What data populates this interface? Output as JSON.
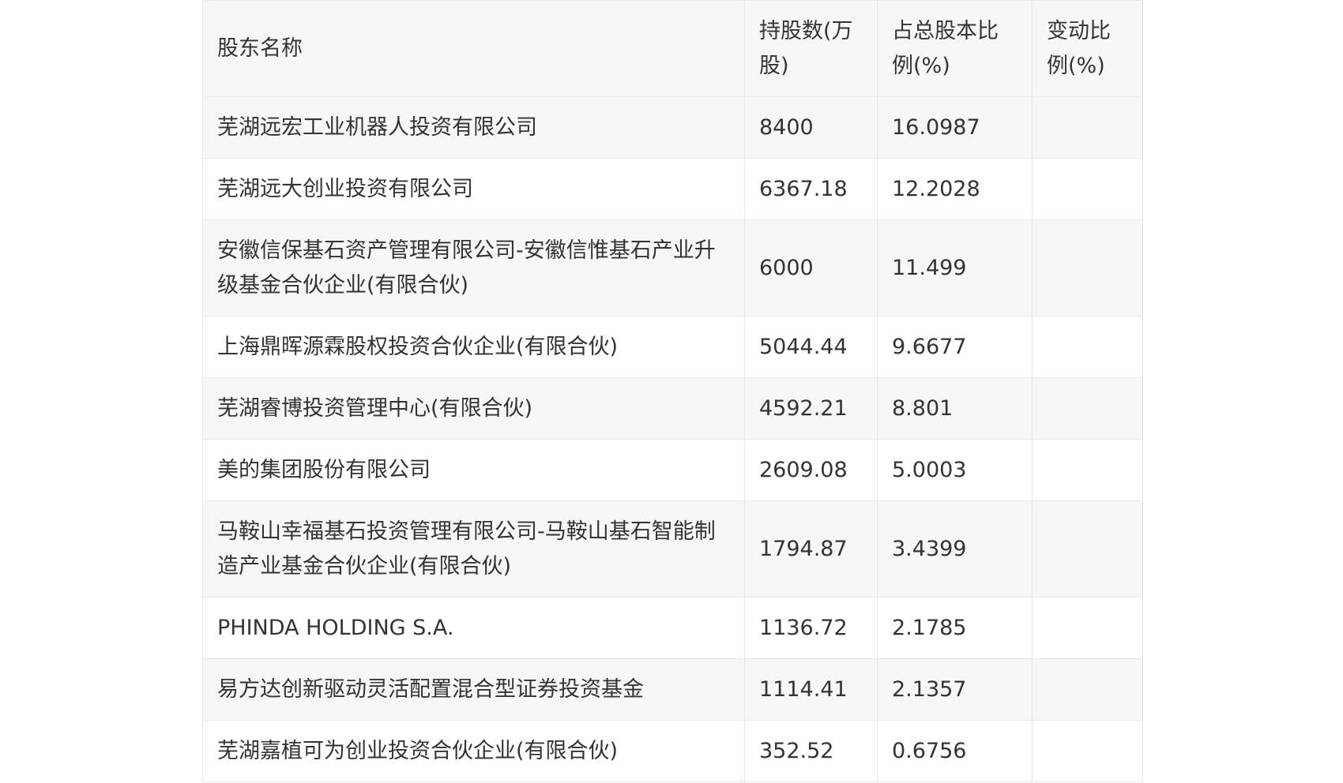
{
  "table": {
    "headers": [
      "股东名称",
      "持股数(万股)",
      "占总股本比例(%)",
      "变动比例(%)"
    ],
    "rows": [
      {
        "name": "芜湖远宏工业机器人投资有限公司",
        "shares": "8400",
        "ratio": "16.0987",
        "change": ""
      },
      {
        "name": "芜湖远大创业投资有限公司",
        "shares": "6367.18",
        "ratio": "12.2028",
        "change": ""
      },
      {
        "name": "安徽信保基石资产管理有限公司-安徽信惟基石产业升级基金合伙企业(有限合伙)",
        "shares": "6000",
        "ratio": "11.499",
        "change": ""
      },
      {
        "name": "上海鼎晖源霖股权投资合伙企业(有限合伙)",
        "shares": "5044.44",
        "ratio": "9.6677",
        "change": ""
      },
      {
        "name": "芜湖睿博投资管理中心(有限合伙)",
        "shares": "4592.21",
        "ratio": "8.801",
        "change": ""
      },
      {
        "name": "美的集团股份有限公司",
        "shares": "2609.08",
        "ratio": "5.0003",
        "change": ""
      },
      {
        "name": "马鞍山幸福基石投资管理有限公司-马鞍山基石智能制造产业基金合伙企业(有限合伙)",
        "shares": "1794.87",
        "ratio": "3.4399",
        "change": ""
      },
      {
        "name": "PHINDA HOLDING S.A.",
        "shares": "1136.72",
        "ratio": "2.1785",
        "change": ""
      },
      {
        "name": "易方达创新驱动灵活配置混合型证券投资基金",
        "shares": "1114.41",
        "ratio": "2.1357",
        "change": ""
      },
      {
        "name": "芜湖嘉植可为创业投资合伙企业(有限合伙)",
        "shares": "352.52",
        "ratio": "0.6756",
        "change": ""
      }
    ]
  }
}
